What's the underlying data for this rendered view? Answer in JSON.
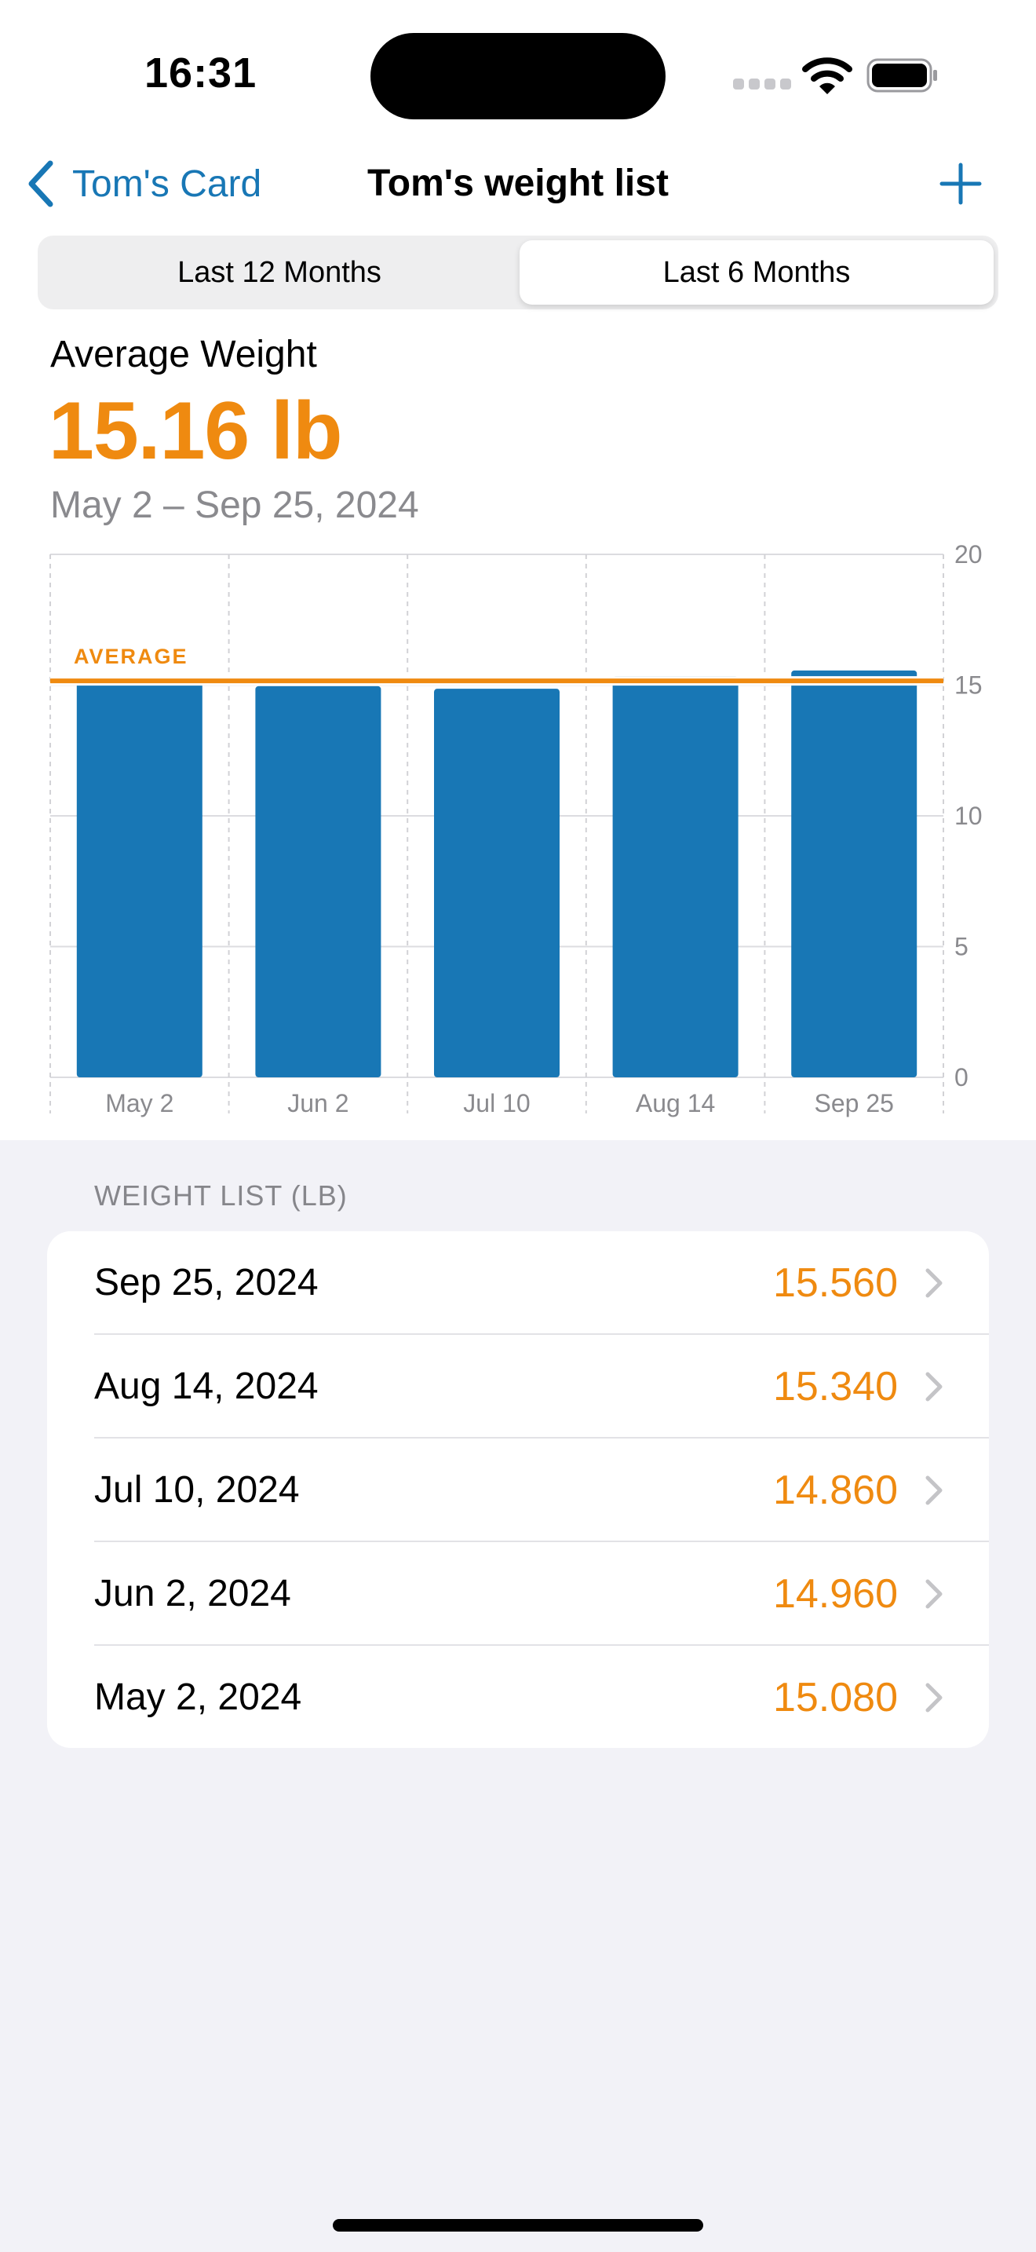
{
  "status_bar": {
    "time": "16:31"
  },
  "nav": {
    "back_label": "Tom's Card",
    "title": "Tom's weight list"
  },
  "segments": [
    {
      "label": "Last 12 Months",
      "selected": false
    },
    {
      "label": "Last 6 Months",
      "selected": true
    }
  ],
  "summary": {
    "label": "Average Weight",
    "value": "15.16 lb",
    "range": "May 2 – Sep 25, 2024"
  },
  "chart_data": {
    "type": "bar",
    "categories": [
      "May 2",
      "Jun 2",
      "Jul 10",
      "Aug 14",
      "Sep 25"
    ],
    "values": [
      15.08,
      14.96,
      14.86,
      15.34,
      15.56
    ],
    "ylim": [
      0,
      20
    ],
    "yticks": [
      "0",
      "5",
      "10",
      "15",
      "20"
    ],
    "average": 15.16,
    "average_label": "AVERAGE",
    "bar_color": "#1877B5",
    "average_color": "#EF8A10",
    "grid": true,
    "y_axis_position": "right"
  },
  "list": {
    "header": "WEIGHT LIST (LB)",
    "rows": [
      {
        "date": "Sep 25, 2024",
        "value": "15.560"
      },
      {
        "date": "Aug 14, 2024",
        "value": "15.340"
      },
      {
        "date": "Jul 10, 2024",
        "value": "14.860"
      },
      {
        "date": "Jun 2, 2024",
        "value": "14.960"
      },
      {
        "date": "May 2, 2024",
        "value": "15.080"
      }
    ]
  },
  "colors": {
    "accent": "#1877B5",
    "highlight": "#EF8A10",
    "background": "#F2F2F7"
  }
}
